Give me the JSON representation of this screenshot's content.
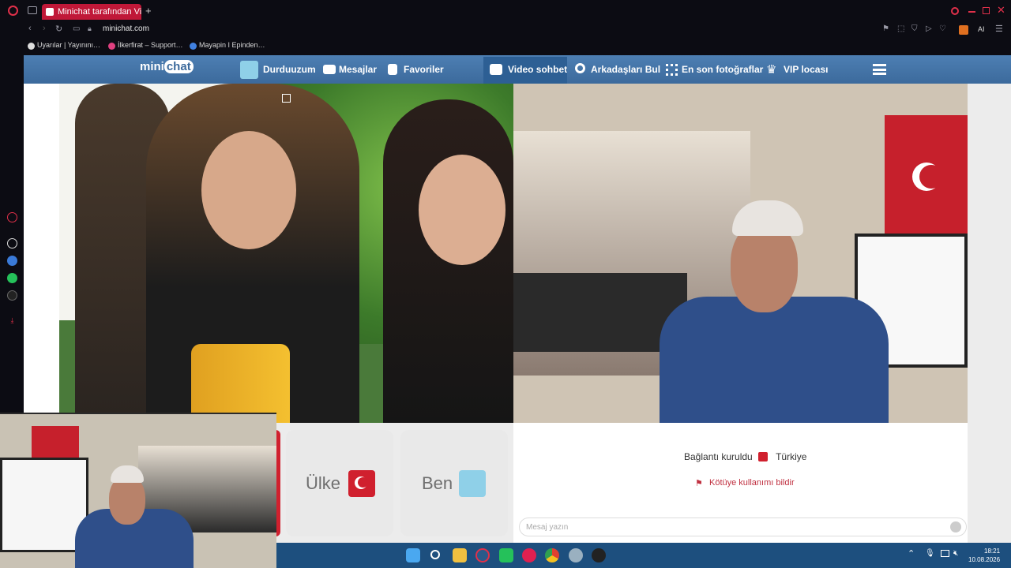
{
  "browser": {
    "tab_title": "Minichat tarafından Vide",
    "url": "minichat.com",
    "bookmarks": [
      "Uyarılar | Yayınını…",
      "İlkerfirat – Support…",
      "Mayapin I Epinden…"
    ],
    "ai_label": "AI"
  },
  "site": {
    "logo_mini": "mini",
    "logo_chat": "chat",
    "nav": [
      "Durduuzum",
      "Mesajlar",
      "Favoriler",
      "Video sohbet",
      "Arkadaşları Bul",
      "En son fotoğraflar",
      "VIP locası"
    ]
  },
  "controls": {
    "country_label": "Ülke",
    "me_label": "Ben"
  },
  "chat": {
    "status": "Bağlantı kuruldu",
    "country": "Türkiye",
    "report": "Kötüye kullanımı bildir",
    "placeholder": "Mesaj yazın"
  },
  "taskbar": {
    "time": "18:21",
    "date": "10.08.2026"
  },
  "colors": {
    "nav_bg": "#3c6a9c",
    "tab_accent": "#c01838",
    "flag_red": "#d0202e",
    "taskbar": "#1d4f7e"
  }
}
